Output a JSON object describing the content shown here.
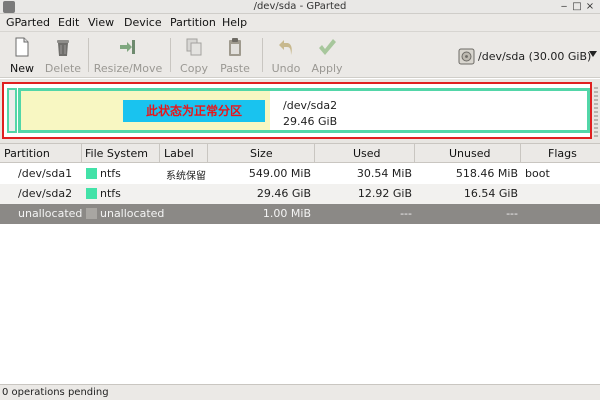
{
  "window": {
    "title": "/dev/sda - GParted"
  },
  "menubar": [
    "GParted",
    "Edit",
    "View",
    "Device",
    "Partition",
    "Help"
  ],
  "toolbar": {
    "new": "New",
    "delete": "Delete",
    "resize_move": "Resize/Move",
    "copy": "Copy",
    "paste": "Paste",
    "undo": "Undo",
    "apply": "Apply"
  },
  "device_selector": {
    "label": "/dev/sda   (30.00 GiB)"
  },
  "disk_map": {
    "annotation": "此状态为正常分区",
    "partition_name": "/dev/sda2",
    "partition_size": "29.46 GiB",
    "used_fraction": 0.44
  },
  "table": {
    "columns": [
      "Partition",
      "File System",
      "Label",
      "Size",
      "Used",
      "Unused",
      "Flags"
    ],
    "rows": [
      {
        "partition": "/dev/sda1",
        "fs": "ntfs",
        "label": "系统保留",
        "size": "549.00 MiB",
        "used": "30.54 MiB",
        "unused": "518.46 MiB",
        "flags": "boot"
      },
      {
        "partition": "/dev/sda2",
        "fs": "ntfs",
        "label": "",
        "size": "29.46 GiB",
        "used": "12.92 GiB",
        "unused": "16.54 GiB",
        "flags": ""
      },
      {
        "partition": "unallocated",
        "fs": "unallocated",
        "label": "",
        "size": "1.00 MiB",
        "used": "---",
        "unused": "---",
        "flags": ""
      }
    ]
  },
  "status": "0 operations pending",
  "colors": {
    "ntfs": "#42e2a8",
    "unallocated": "#a8a6a2",
    "used_space": "#f8f7c2",
    "highlight_border": "#e02020"
  }
}
